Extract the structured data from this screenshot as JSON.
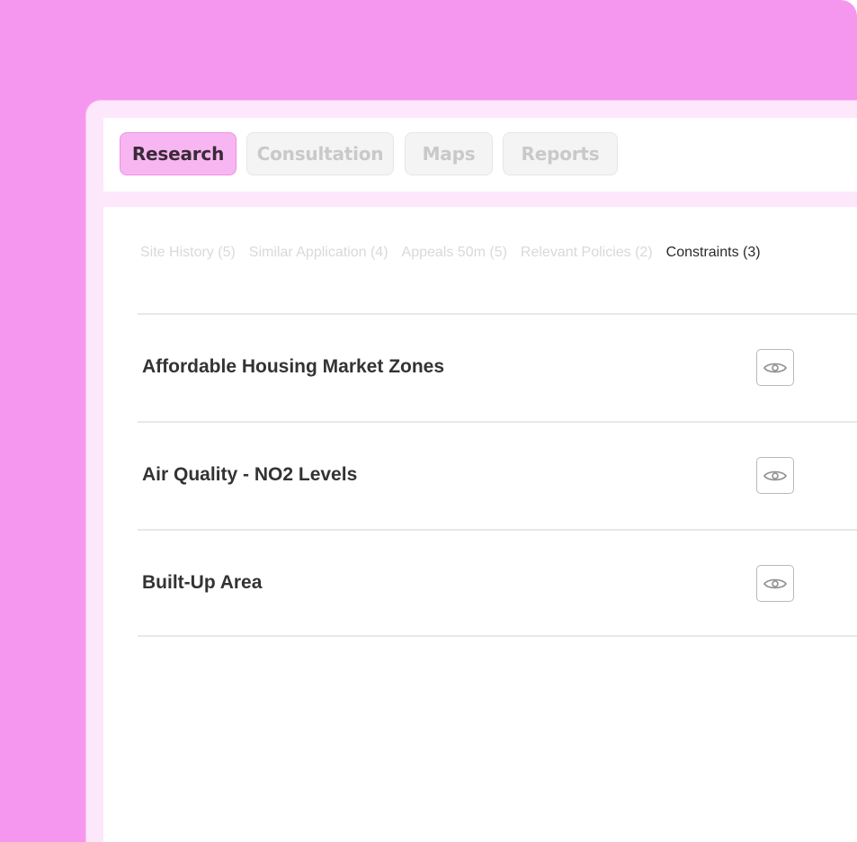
{
  "colors": {
    "background_accent": "#f697ef",
    "active_tab_bg": "#f7b6f1",
    "active_tab_border": "#ee8fe5",
    "inactive_tab_text": "#c9c9c9"
  },
  "main_tabs": [
    {
      "label": "Research",
      "active": true
    },
    {
      "label": "Consultation",
      "active": false
    },
    {
      "label": "Maps",
      "active": false
    },
    {
      "label": "Reports",
      "active": false
    }
  ],
  "sub_tabs": [
    {
      "label": "Site History (5)",
      "active": false
    },
    {
      "label": "Similar Application (4)",
      "active": false
    },
    {
      "label": "Appeals 50m (5)",
      "active": false
    },
    {
      "label": "Relevant Policies (2)",
      "active": false
    },
    {
      "label": "Constraints (3)",
      "active": true
    }
  ],
  "constraints": [
    {
      "title": "Affordable Housing Market Zones",
      "action_icon": "eye-icon"
    },
    {
      "title": "Air Quality - NO2 Levels",
      "action_icon": "eye-icon"
    },
    {
      "title": "Built-Up Area",
      "action_icon": "eye-icon"
    }
  ]
}
